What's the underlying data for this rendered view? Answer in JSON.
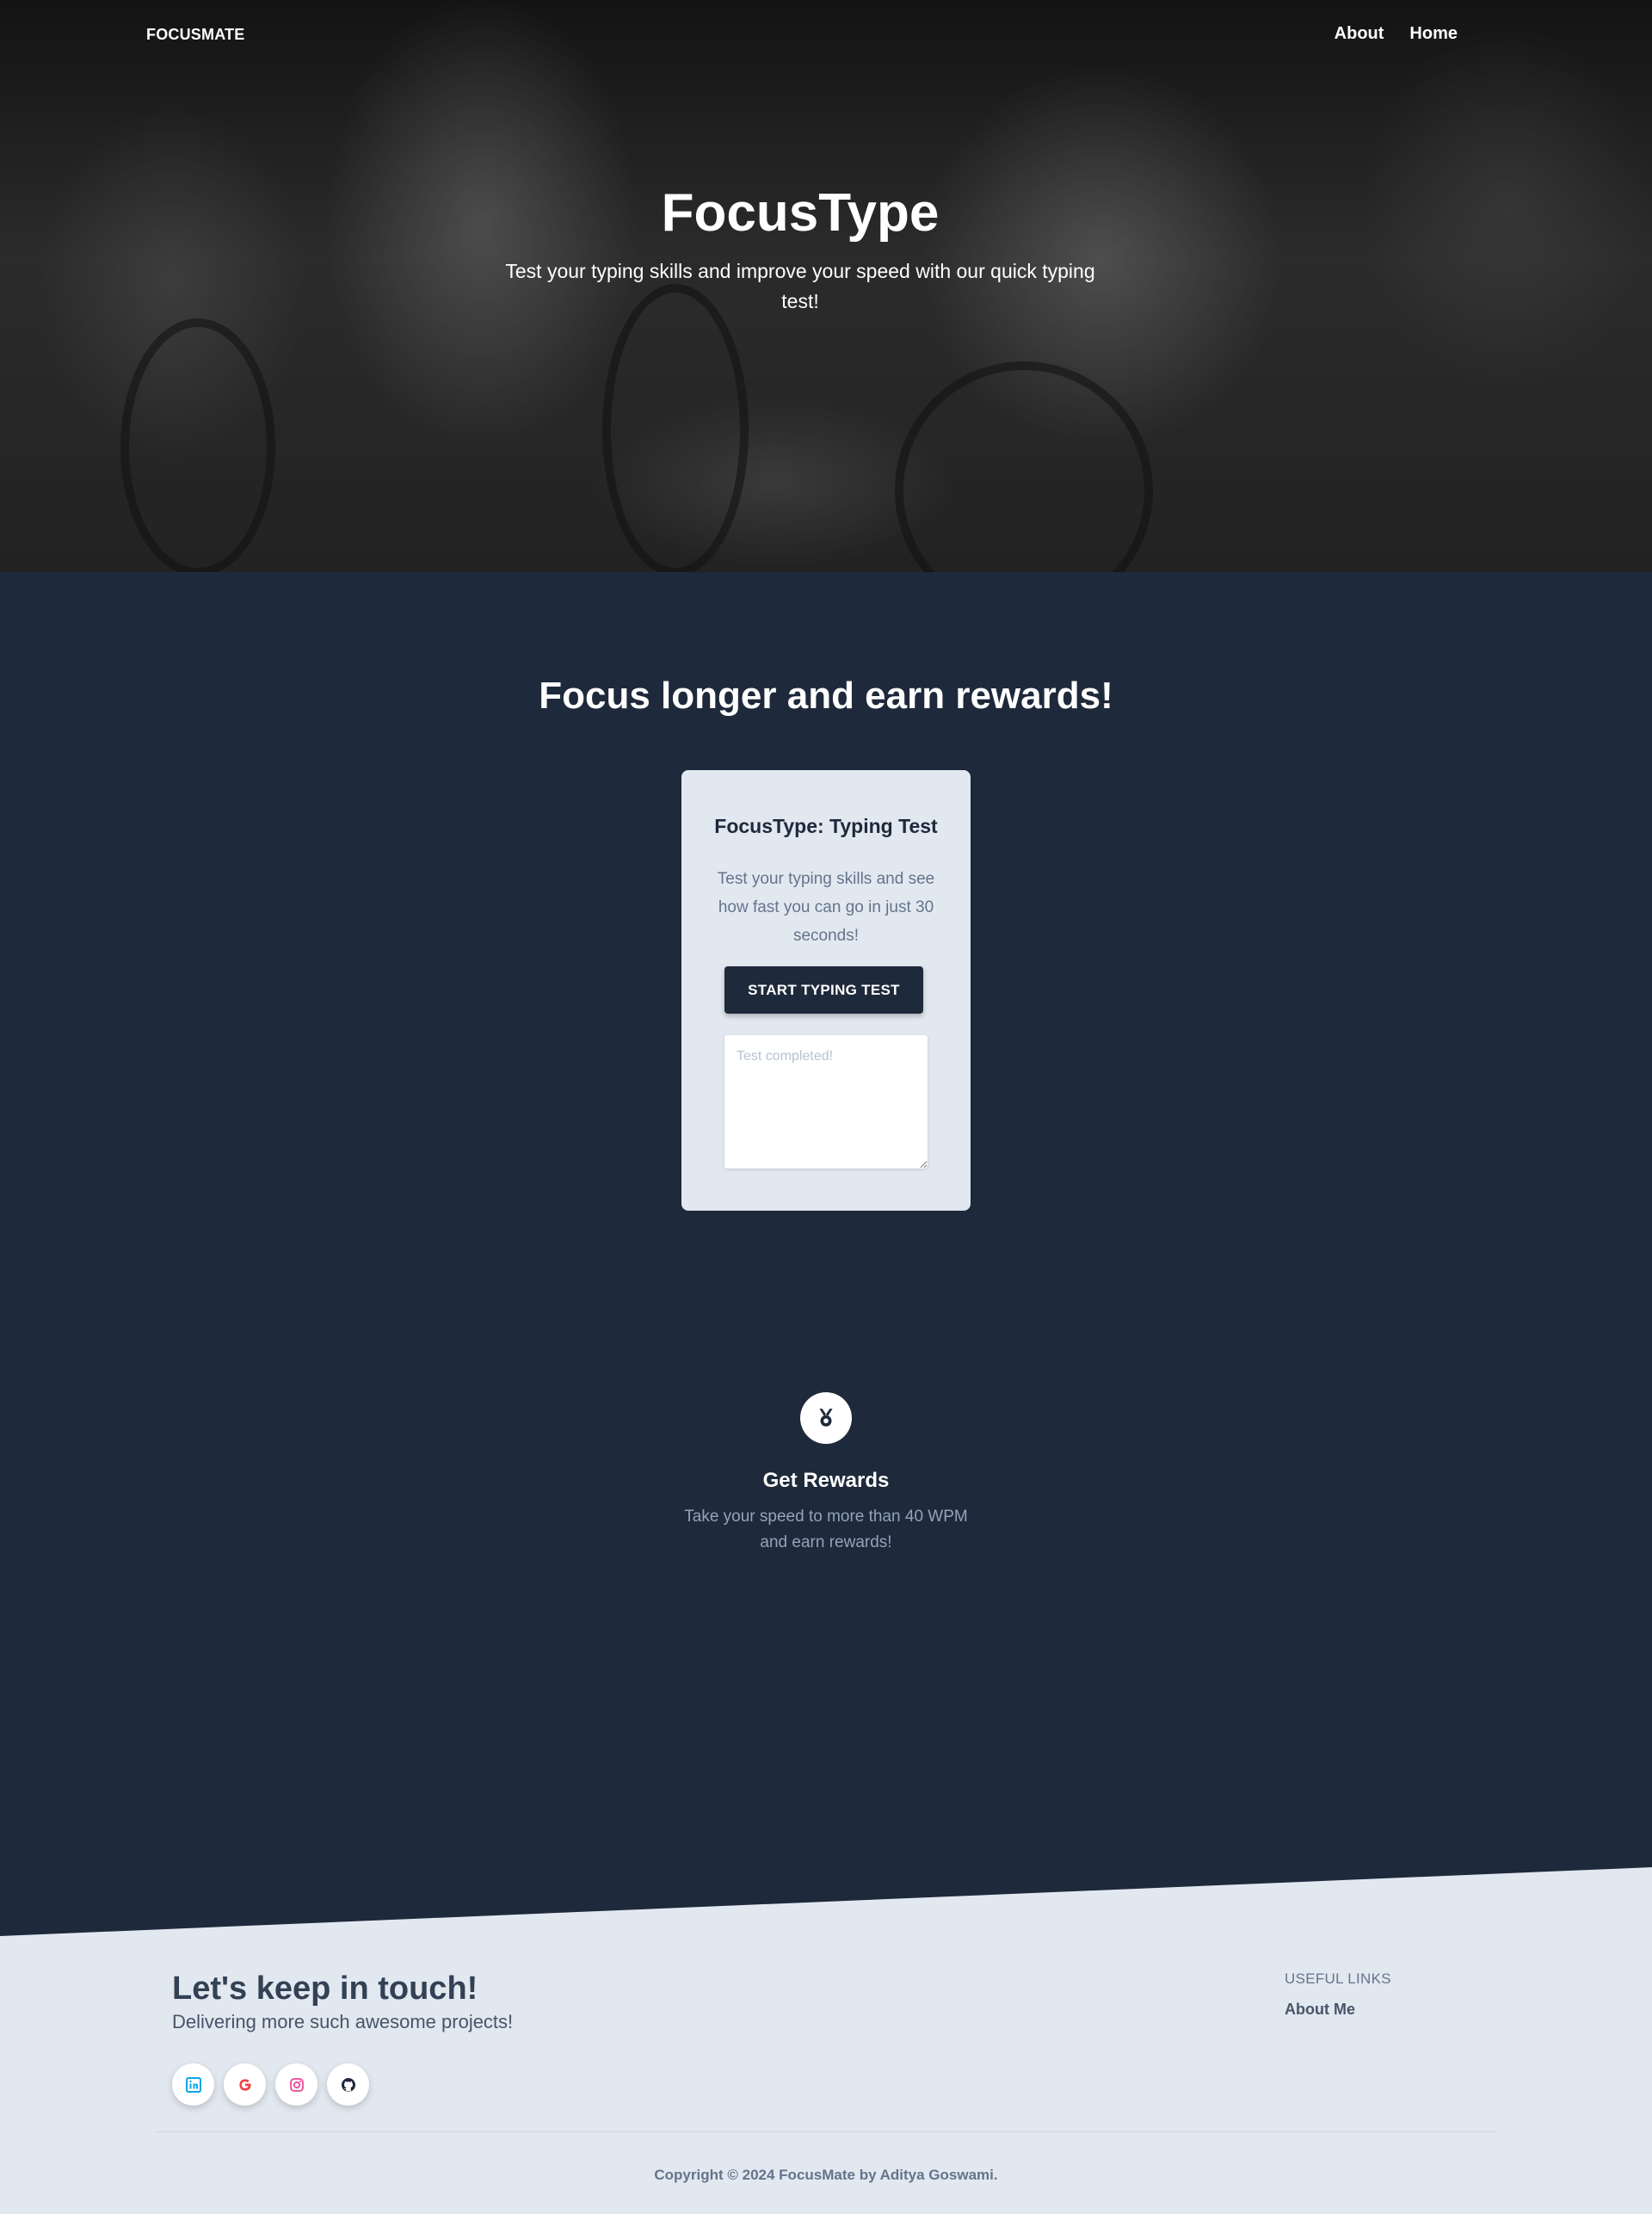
{
  "nav": {
    "brand": "FOCUSMATE",
    "links": [
      "About",
      "Home"
    ]
  },
  "hero": {
    "title": "FocusType",
    "subtitle": "Test your typing skills and improve your speed with our quick typing test!"
  },
  "main": {
    "heading": "Focus longer and earn rewards!",
    "card": {
      "title": "FocusType: Typing Test",
      "description": "Test your typing skills and see how fast you can go in just 30 seconds!",
      "button_label": "START TYPING TEST",
      "result_placeholder": "Test completed!"
    },
    "reward": {
      "icon": "medal-icon",
      "title": "Get Rewards",
      "description": "Take your speed to more than 40 WPM and earn rewards!"
    }
  },
  "footer": {
    "title": "Let's keep in touch!",
    "subtitle": "Delivering more such awesome projects!",
    "socials": [
      {
        "icon": "linkedin-icon",
        "color": "#0ea5e9"
      },
      {
        "icon": "google-icon",
        "color": "#ef4444"
      },
      {
        "icon": "instagram-icon",
        "color": "#ec4899"
      },
      {
        "icon": "github-icon",
        "color": "#1e293b"
      }
    ],
    "links_heading": "USEFUL LINKS",
    "links": [
      "About Me"
    ],
    "copyright": "Copyright © 2024 FocusMate by Aditya Goswami."
  },
  "colors": {
    "dark": "#1e293b",
    "light": "#e2e8f0",
    "muted": "#64748b"
  }
}
